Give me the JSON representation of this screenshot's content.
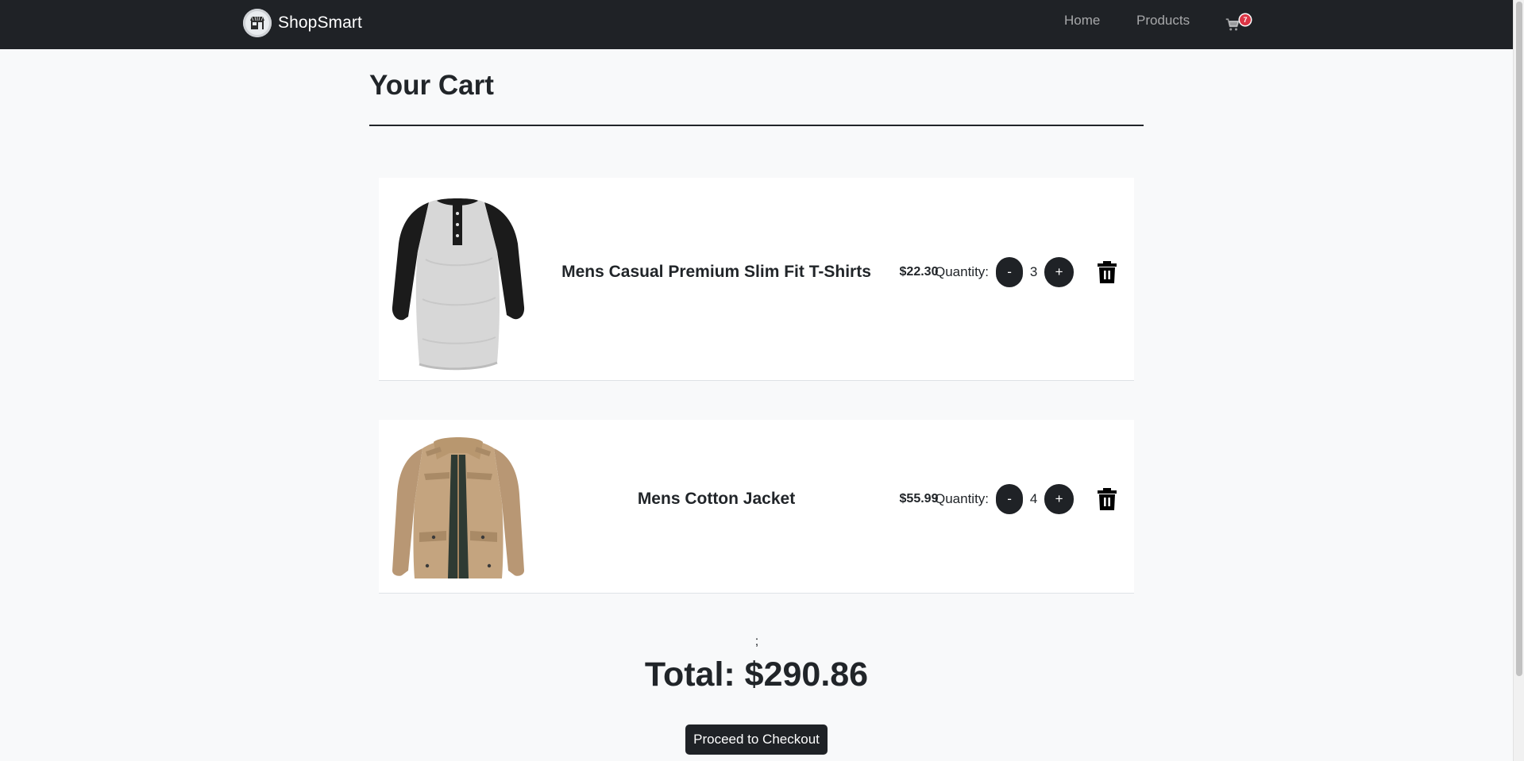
{
  "navbar": {
    "brand": "ShopSmart",
    "links": {
      "home": "Home",
      "products": "Products"
    },
    "cart_count": "7",
    "icons": {
      "brand": "storefront-icon",
      "cart": "shopping-cart-icon"
    }
  },
  "page": {
    "title": "Your Cart"
  },
  "cart": {
    "quantity_label": "Quantity:",
    "decrement_label": "-",
    "increment_label": "+",
    "items": [
      {
        "name": "Mens Casual Premium Slim Fit T-Shirts",
        "price": "$22.30",
        "quantity": "3",
        "image": "henley-shirt-image"
      },
      {
        "name": "Mens Cotton Jacket",
        "price": "$55.99",
        "quantity": "4",
        "image": "cotton-jacket-image"
      }
    ]
  },
  "summary": {
    "stray_text": ";",
    "total": "Total: $290.86",
    "checkout_label": "Proceed to Checkout"
  },
  "colors": {
    "navbar_bg": "#1f2226",
    "page_bg": "#f8f9fa",
    "badge": "#dc3545",
    "button_bg": "#1f2226"
  }
}
